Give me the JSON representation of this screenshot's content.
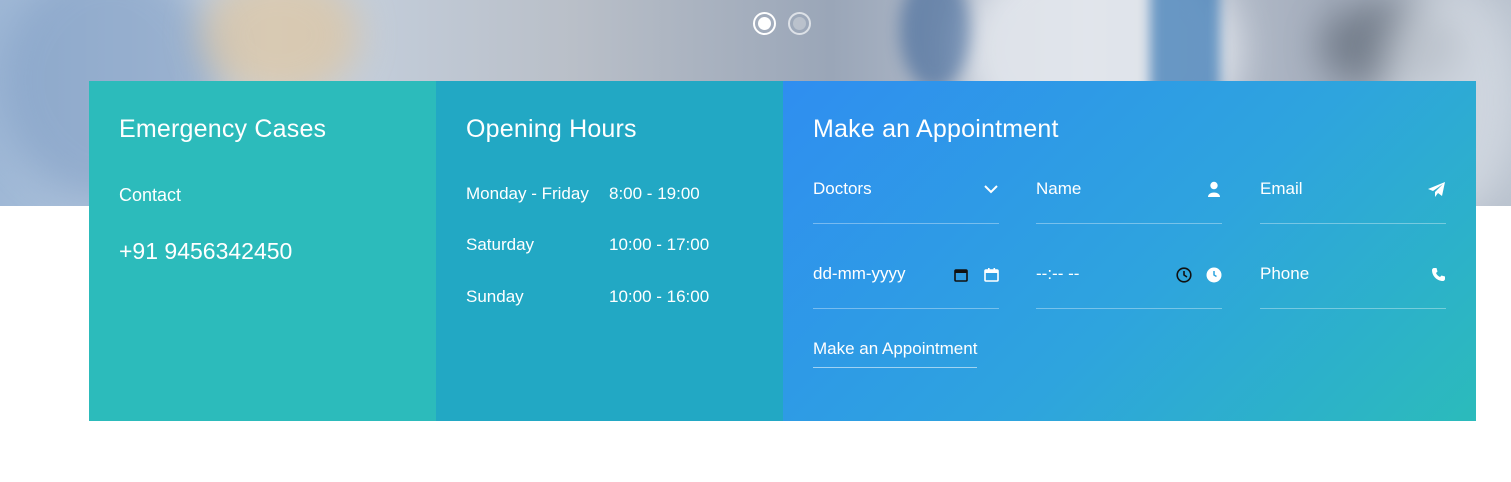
{
  "slider": {
    "active_index": 0,
    "dot_count": 2
  },
  "emergency": {
    "title": "Emergency Cases",
    "contact_label": "Contact",
    "phone": "+91 9456342450"
  },
  "hours": {
    "title": "Opening Hours",
    "rows": [
      {
        "day": "Monday - Friday",
        "time": "8:00 - 19:00"
      },
      {
        "day": "Saturday",
        "time": "10:00 - 17:00"
      },
      {
        "day": "Sunday",
        "time": "10:00 - 16:00"
      }
    ]
  },
  "appointment": {
    "title": "Make an Appointment",
    "doctors_select": "Doctors",
    "name_placeholder": "Name",
    "email_placeholder": "Email",
    "date_placeholder": "dd-mm-yyyy",
    "time_placeholder": "--:-- --",
    "phone_placeholder": "Phone",
    "submit_label": "Make an Appointment"
  },
  "colors": {
    "emergency_bg": "#2cbbbb",
    "hours_bg": "#22a8c4",
    "appointment_gradient_start": "#2f8ef0",
    "appointment_gradient_end": "#2bbbbb"
  },
  "icons": {
    "doctors": "chevron-down-icon",
    "name": "user-icon",
    "email": "paper-plane-icon",
    "date": "calendar-icon",
    "time": "clock-icon",
    "phone": "phone-icon"
  }
}
